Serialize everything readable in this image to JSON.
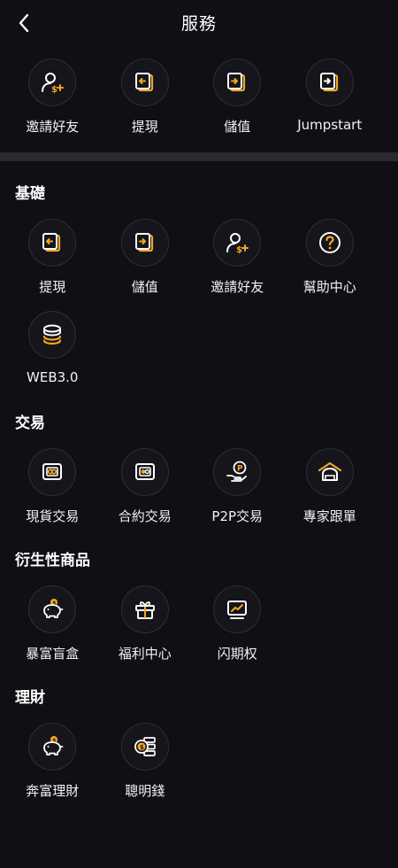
{
  "header": {
    "title": "服務"
  },
  "colors": {
    "background": "#0f0f14",
    "accent": "#f5a623",
    "icon_stroke": "#ffffff",
    "divider": "#2a2a2e"
  },
  "top_items": [
    {
      "label": "邀請好友",
      "icon": "invite-friend"
    },
    {
      "label": "提現",
      "icon": "withdraw"
    },
    {
      "label": "儲值",
      "icon": "deposit"
    },
    {
      "label": "Jumpstart",
      "icon": "jumpstart"
    }
  ],
  "sections": [
    {
      "title": "基礎",
      "items": [
        {
          "label": "提現",
          "icon": "withdraw"
        },
        {
          "label": "儲值",
          "icon": "deposit"
        },
        {
          "label": "邀請好友",
          "icon": "invite-friend"
        },
        {
          "label": "幫助中心",
          "icon": "help"
        },
        {
          "label": "WEB3.0",
          "icon": "web3"
        }
      ]
    },
    {
      "title": "交易",
      "items": [
        {
          "label": "現貨交易",
          "icon": "spot"
        },
        {
          "label": "合約交易",
          "icon": "contract"
        },
        {
          "label": "P2P交易",
          "icon": "p2p"
        },
        {
          "label": "專家跟單",
          "icon": "copy-trade"
        }
      ]
    },
    {
      "title": "衍生性商品",
      "items": [
        {
          "label": "暴富盲盒",
          "icon": "piggy"
        },
        {
          "label": "福利中心",
          "icon": "gift"
        },
        {
          "label": "闪期权",
          "icon": "option"
        }
      ]
    },
    {
      "title": "理財",
      "items": [
        {
          "label": "奔富理財",
          "icon": "piggy"
        },
        {
          "label": "聰明錢",
          "icon": "smart-money"
        }
      ]
    }
  ]
}
